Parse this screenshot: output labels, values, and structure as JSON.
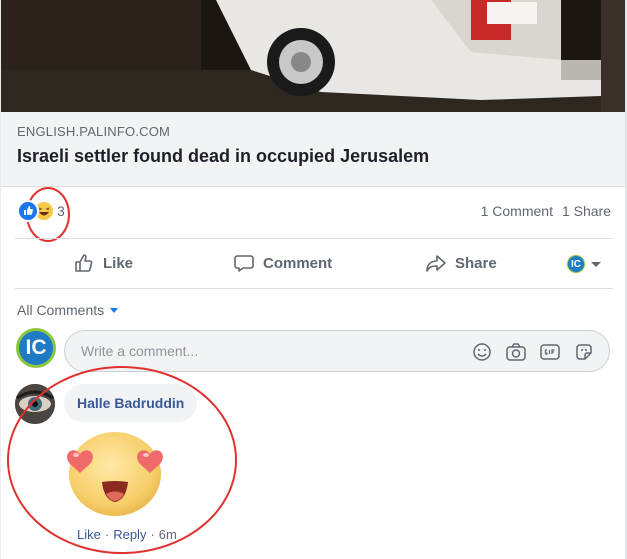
{
  "link_preview": {
    "domain": "ENGLISH.PALINFO.COM",
    "headline": "Israeli settler found dead in occupied Jerusalem",
    "photo_icon": "vehicle-photo"
  },
  "stats": {
    "reaction_icons": [
      "like-reaction-icon",
      "haha-reaction-icon"
    ],
    "reaction_count": "3",
    "comments": "1 Comment",
    "shares": "1 Share"
  },
  "actions": {
    "like": "Like",
    "comment": "Comment",
    "share": "Share",
    "page_avatar_text": "IC"
  },
  "comments": {
    "sort_label": "All Comments",
    "avatar_text": "IC",
    "input_placeholder": "Write a comment...",
    "composer_icons": [
      "emoji-icon",
      "camera-icon",
      "gif-icon",
      "sticker-icon"
    ],
    "items": [
      {
        "author": "Halle Badruddin",
        "sticker": "heart-eyes-sticker",
        "like": "Like",
        "separator": "·",
        "reply": "Reply",
        "time": "6m"
      }
    ]
  },
  "colors": {
    "highlight_circle": "#e0312e",
    "link_blue": "#385898",
    "facebook_blue": "#1877f2"
  }
}
